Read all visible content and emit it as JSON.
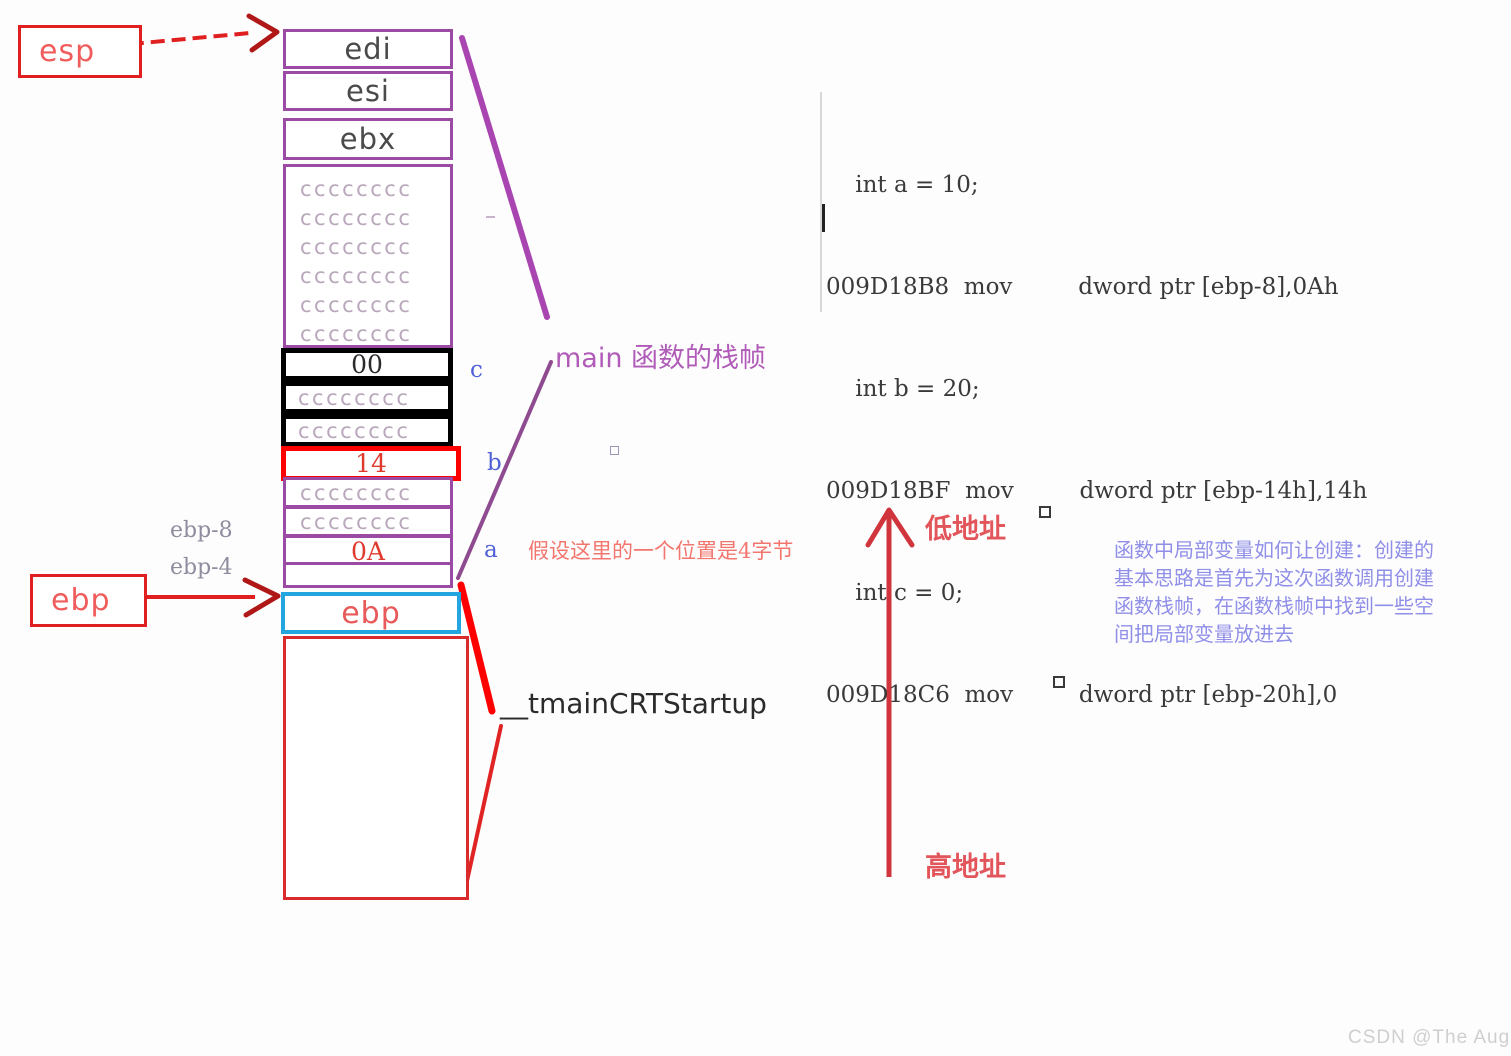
{
  "diagram": {
    "title": "main function stack frame layout",
    "registers": {
      "esp_label": "esp",
      "ebp_label": "ebp"
    },
    "stack_cells": [
      {
        "text": "edi",
        "style": "register",
        "border": "purple"
      },
      {
        "text": "esi",
        "style": "register",
        "border": "purple"
      },
      {
        "text": "ebx",
        "style": "register",
        "border": "purple"
      }
    ],
    "filler_rows": [
      "cccccccc",
      "cccccccc",
      "cccccccc",
      "cccccccc",
      "cccccccc",
      "cccccccc"
    ],
    "var_cells": [
      {
        "text": "00",
        "border": "black",
        "note": "c"
      },
      {
        "text": "cccccccc",
        "border": "black",
        "note": ""
      },
      {
        "text": "cccccccc",
        "border": "black",
        "note": ""
      },
      {
        "text": "14",
        "border": "red",
        "note": "b"
      },
      {
        "text": "cccccccc",
        "border": "purple",
        "note": ""
      },
      {
        "text": "cccccccc",
        "border": "purple",
        "note": ""
      },
      {
        "text": "0A",
        "border": "purple",
        "note": "a"
      },
      {
        "text": "",
        "border": "purple",
        "note": ""
      }
    ],
    "ebp_cell_text": "ebp",
    "offsets": {
      "ebp_minus_8": "ebp-8",
      "ebp_minus_4": "ebp-4"
    },
    "var_letters": {
      "c": "c",
      "b": "b",
      "a": "a"
    },
    "annotations": {
      "main_frame": "main 函数的栈帧",
      "four_bytes": "假设这里的一个位置是4字节",
      "crt_startup": "__tmainCRTStartup",
      "low_address": "低地址",
      "high_address": "高地址",
      "explanation": "函数中局部变量如何让创建：创建的基本思路是首先为这次函数调用创建函数栈帧，在函数栈帧中找到一些空间把局部变量放进去"
    },
    "code_listing": [
      "    int a = 10;",
      "009D18B8  mov         dword ptr [ebp-8],0Ah",
      "    int b = 20;",
      "009D18BF  mov         dword ptr [ebp-14h],14h",
      "    int c = 0;",
      "009D18C6  mov         dword ptr [ebp-20h],0"
    ],
    "watermark": "CSDN @The  August",
    "colors": {
      "purple": "#9b4ba3",
      "red": "#e02020",
      "cyan": "#23a6e0",
      "black": "#000000",
      "blue_text": "#4f5fd6",
      "faded_cc": "#b9a7bb"
    }
  }
}
